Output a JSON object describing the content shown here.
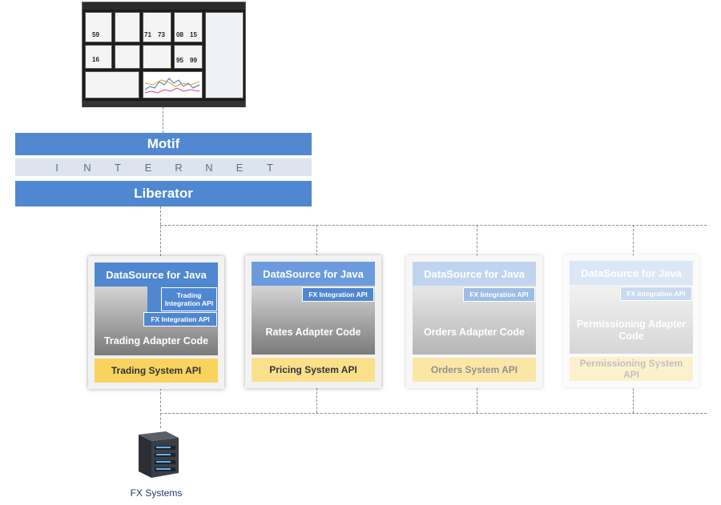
{
  "layers": {
    "motif": "Motif",
    "internet": [
      "I",
      "N",
      "T",
      "E",
      "R",
      "N",
      "E",
      "T"
    ],
    "liberator": "Liberator"
  },
  "cards": [
    {
      "datasource": "DataSource for Java",
      "trading_api": "Trading Integration API",
      "fx_api": "FX Integration API",
      "adapter": "Trading Adapter Code",
      "system_api": "Trading System API"
    },
    {
      "datasource": "DataSource for Java",
      "fx_api": "FX Integration API",
      "adapter": "Rates Adapter Code",
      "system_api": "Pricing System API"
    },
    {
      "datasource": "DataSource for Java",
      "fx_api": "FX Integration API",
      "adapter": "Orders Adapter Code",
      "system_api": "Orders System API"
    },
    {
      "datasource": "DataSource for Java",
      "fx_api": "FX Integration API",
      "adapter": "Permissioning Adapter Code",
      "system_api": "Permissioning System API"
    }
  ],
  "server": {
    "label": "FX Systems",
    "icon": "server-icon"
  },
  "screenshot": {
    "icon": "trading-app-screenshot",
    "prices": [
      "59",
      "71",
      "73",
      "08",
      "15",
      "16",
      "95",
      "99"
    ]
  },
  "colors": {
    "blue": "#4f87d0",
    "yellow": "#fad35e",
    "internet_band": "#dde4ed"
  }
}
